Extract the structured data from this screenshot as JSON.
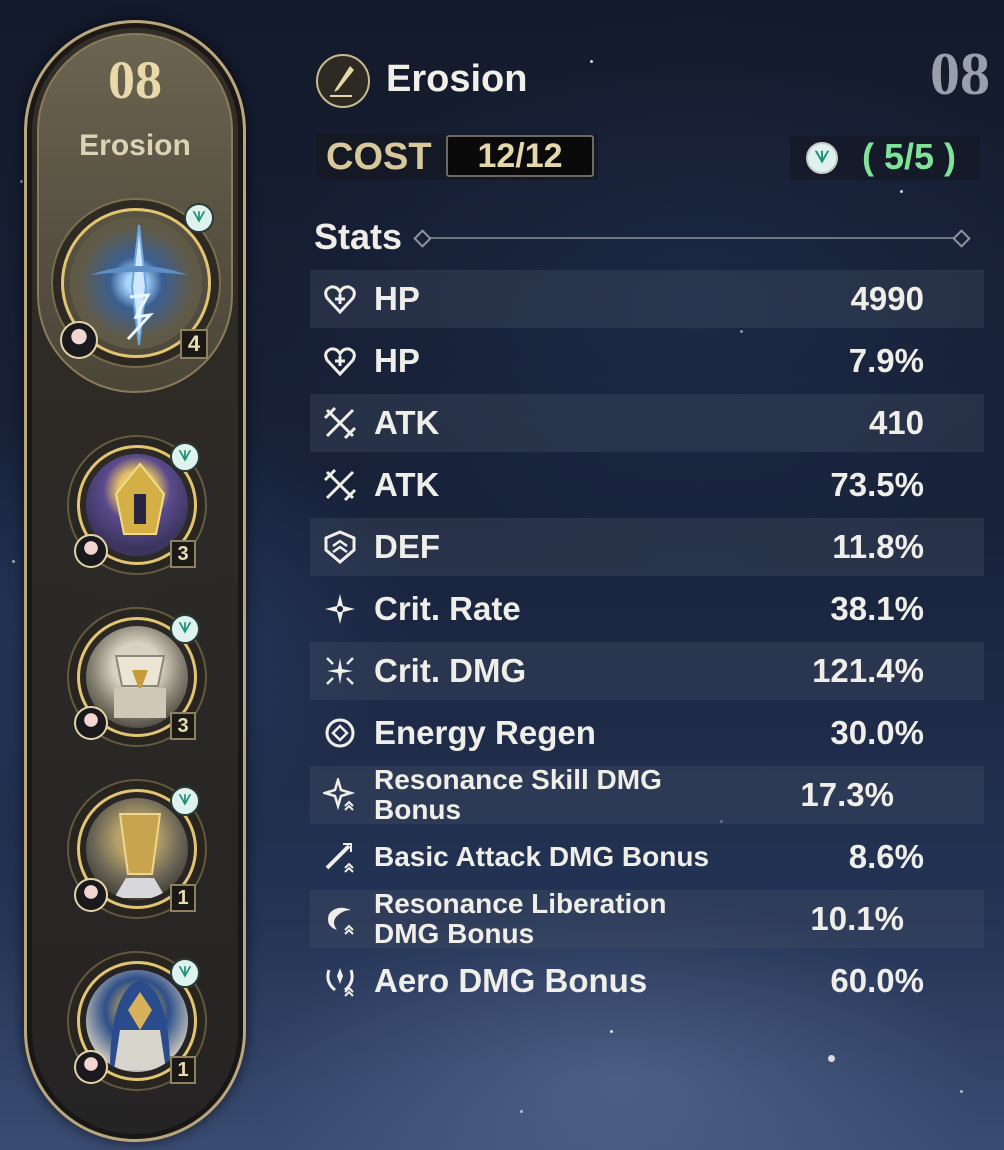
{
  "left_panel": {
    "cost_number": "08",
    "set_name": "Erosion",
    "echoes": [
      {
        "level": "4"
      },
      {
        "level": "3"
      },
      {
        "level": "3"
      },
      {
        "level": "1"
      },
      {
        "level": "1"
      }
    ]
  },
  "header": {
    "set_name": "Erosion",
    "echo_number": "08",
    "cost_label": "COST",
    "cost_value": "12/12",
    "sonata_count": "( 5/5 )"
  },
  "stats": {
    "heading": "Stats",
    "rows": [
      {
        "label": "HP",
        "value": "4990",
        "icon": "hp-icon"
      },
      {
        "label": "HP",
        "value": "7.9%",
        "icon": "hp-icon"
      },
      {
        "label": "ATK",
        "value": "410",
        "icon": "atk-icon"
      },
      {
        "label": "ATK",
        "value": "73.5%",
        "icon": "atk-icon"
      },
      {
        "label": "DEF",
        "value": "11.8%",
        "icon": "def-icon"
      },
      {
        "label": "Crit. Rate",
        "value": "38.1%",
        "icon": "crit-rate-icon"
      },
      {
        "label": "Crit. DMG",
        "value": "121.4%",
        "icon": "crit-dmg-icon"
      },
      {
        "label": "Energy Regen",
        "value": "30.0%",
        "icon": "energy-regen-icon"
      },
      {
        "label": "Resonance Skill DMG Bonus",
        "value": "17.3%",
        "icon": "resonance-skill-icon"
      },
      {
        "label": "Basic Attack DMG Bonus",
        "value": "8.6%",
        "icon": "basic-attack-icon"
      },
      {
        "label": "Resonance Liberation DMG Bonus",
        "value": "10.1%",
        "icon": "resonance-liberation-icon"
      },
      {
        "label": "Aero DMG Bonus",
        "value": "60.0%",
        "icon": "aero-dmg-icon"
      }
    ]
  },
  "colors": {
    "gold": "#e3c470",
    "sonata_green": "#7fe39a",
    "text": "#f0eee8"
  }
}
